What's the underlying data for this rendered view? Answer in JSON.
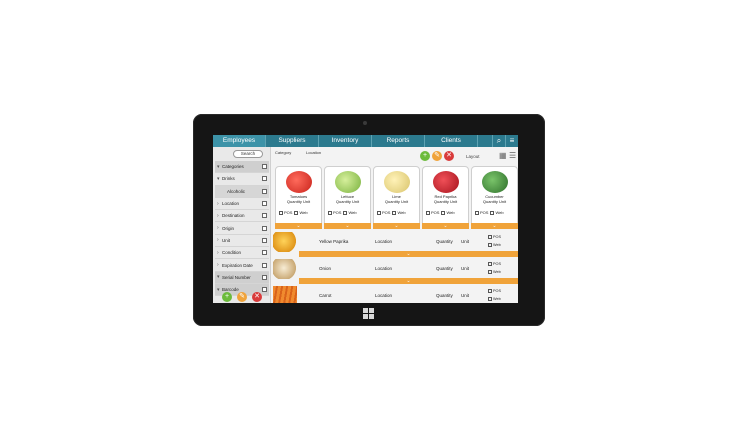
{
  "nav": {
    "items": [
      {
        "label": "Employees"
      },
      {
        "label": "Suppliers"
      },
      {
        "label": "Inventory"
      },
      {
        "label": "Reports"
      },
      {
        "label": "Clients"
      }
    ],
    "icons": [
      "search-icon",
      "menu-icon"
    ]
  },
  "sidebar": {
    "search_label": "Search",
    "items": [
      {
        "label": "Categories"
      },
      {
        "label": "Drinks"
      },
      {
        "label": "Alcoholic"
      },
      {
        "label": "Location"
      },
      {
        "label": "Destination"
      },
      {
        "label": "Origin"
      },
      {
        "label": "Unit"
      },
      {
        "label": "Condition"
      },
      {
        "label": "Expiration Date"
      },
      {
        "label": "Serial Number"
      },
      {
        "label": "Barcode"
      }
    ]
  },
  "toolbar": {
    "category_label": "Category",
    "location_label": "Location",
    "layout_label": "Layout"
  },
  "cards": [
    {
      "name": "Tomatoes",
      "quantity": "Quantity",
      "unit": "Unit",
      "pos": "POS",
      "web": "Web",
      "color": "#d8342a"
    },
    {
      "name": "Lettuce",
      "quantity": "Quantity",
      "unit": "Unit",
      "pos": "POS",
      "web": "Web",
      "color": "#9ccf5a"
    },
    {
      "name": "Lime",
      "quantity": "Quantity",
      "unit": "Unit",
      "pos": "POS",
      "web": "Web",
      "color": "#e8d98a"
    },
    {
      "name": "Red Paprika",
      "quantity": "Quantity",
      "unit": "Unit",
      "pos": "POS",
      "web": "Web",
      "color": "#c9222c"
    },
    {
      "name": "Cucumber",
      "quantity": "Quantity",
      "unit": "Unit",
      "pos": "POS",
      "web": "Web",
      "color": "#3f8a3a"
    }
  ],
  "rows": [
    {
      "name": "Yellow Paprika",
      "location": "Location",
      "quantity": "Quantity",
      "unit": "Unit",
      "pos": "POS",
      "web": "Web",
      "color": "#f2b21e"
    },
    {
      "name": "Onion",
      "location": "Location",
      "quantity": "Quantity",
      "unit": "Unit",
      "pos": "POS",
      "web": "Web",
      "color": "#e8d6b0"
    },
    {
      "name": "Carrot",
      "location": "Location",
      "quantity": "Quantity",
      "unit": "Unit",
      "pos": "POS",
      "web": "Web",
      "color": "#e87a2a"
    }
  ],
  "colors": {
    "nav": "#2c7a8e",
    "accent": "#f0a33a",
    "add": "#6cbb3c",
    "edit": "#f0a33a",
    "delete": "#d93b3b"
  }
}
